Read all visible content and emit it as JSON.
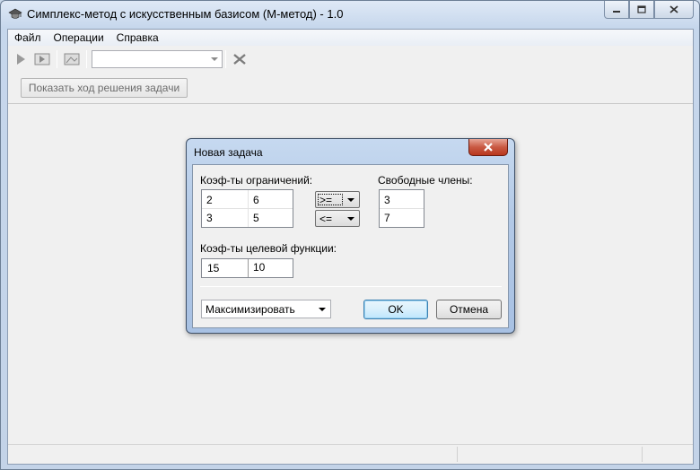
{
  "window": {
    "title": "Симплекс-метод с искусственным базисом (М-метод) - 1.0"
  },
  "menu": {
    "items": [
      {
        "label": "Файл"
      },
      {
        "label": "Операции"
      },
      {
        "label": "Справка"
      }
    ]
  },
  "toolbar": {
    "combo_value": "",
    "icons": [
      "play-icon",
      "step-icon",
      "image-icon",
      "clear-icon"
    ]
  },
  "main": {
    "show_solution_label": "Показать ход решения задачи"
  },
  "dialog": {
    "title": "Новая задача",
    "constraints_label": "Коэф-ты ограничений:",
    "constraints": [
      [
        "2",
        "6"
      ],
      [
        "3",
        "5"
      ]
    ],
    "signs": [
      ">=",
      "<="
    ],
    "free_terms_label": "Свободные члены:",
    "free_terms": [
      "3",
      "7"
    ],
    "objective_label": "Коэф-ты целевой функции:",
    "objective": [
      "15",
      "10"
    ],
    "mode_value": "Максимизировать",
    "ok_label": "OK",
    "cancel_label": "Отмена"
  },
  "colors": {
    "title_bar": "#c6d7ec",
    "close_button": "#c95a43",
    "default_button_border": "#3c7fb1"
  }
}
